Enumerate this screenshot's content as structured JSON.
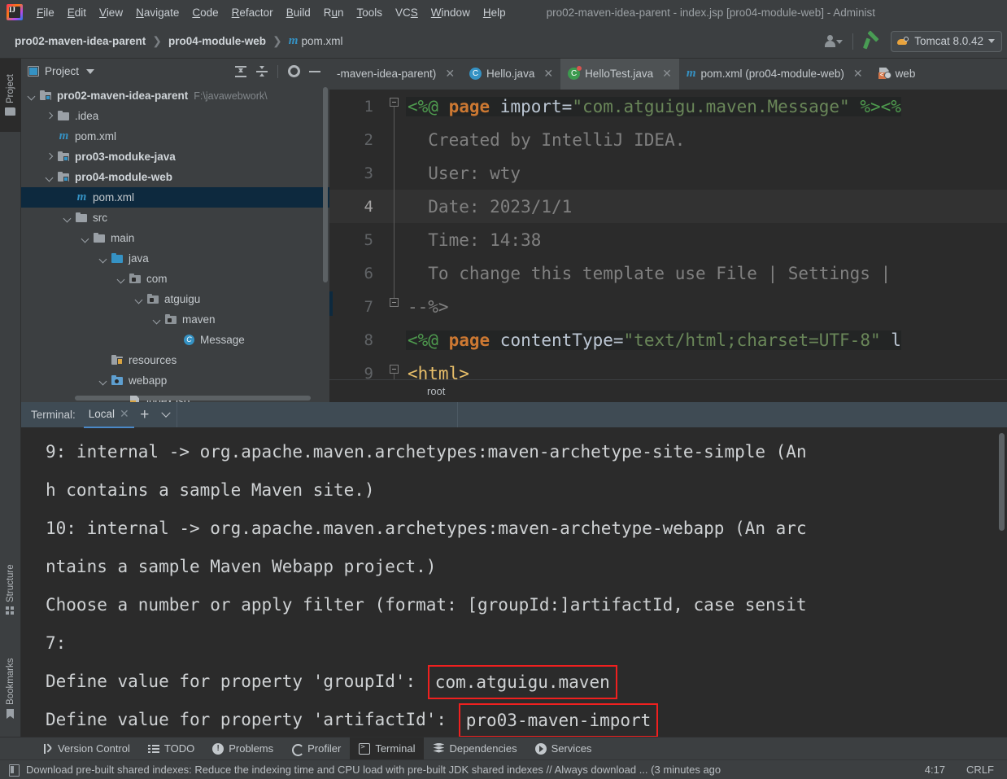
{
  "menubar": {
    "logo_icon": "intellij-idea-logo",
    "items": [
      "File",
      "Edit",
      "View",
      "Navigate",
      "Code",
      "Refactor",
      "Build",
      "Run",
      "Tools",
      "VCS",
      "Window",
      "Help"
    ],
    "window_title": "pro02-maven-idea-parent - index.jsp [pro04-module-web] - Administ"
  },
  "navbar": {
    "breadcrumbs": [
      {
        "label": "pro02-maven-idea-parent",
        "bold": true,
        "icon": null
      },
      {
        "label": "pro04-module-web",
        "bold": true,
        "icon": null
      },
      {
        "label": "pom.xml",
        "bold": false,
        "icon": "maven-m-icon"
      }
    ],
    "account_icon": "user-account-icon",
    "build_icon": "hammer-build-icon",
    "run_config": {
      "label": "Tomcat 8.0.42",
      "icon": "tomcat-icon",
      "caret": "chevron-down-icon"
    }
  },
  "left_strip": {
    "tabs": [
      {
        "label": "Project",
        "icon": "folder-icon",
        "selected": true
      },
      {
        "label": "Structure",
        "icon": "structure-squares-icon",
        "selected": false
      },
      {
        "label": "Bookmarks",
        "icon": "bookmark-icon",
        "selected": false
      }
    ]
  },
  "project_panel": {
    "title": "Project",
    "title_icon": "project-view-icon",
    "dropdown_icon": "chevron-down-icon",
    "tools": [
      {
        "name": "expand-all-icon"
      },
      {
        "name": "collapse-all-icon"
      },
      {
        "name": "gear-settings-icon"
      },
      {
        "name": "hide-panel-icon"
      }
    ],
    "tree": [
      {
        "indent": 0,
        "arrow": "down",
        "icon": "module-folder-icon",
        "label": "pro02-maven-idea-parent",
        "bold": true,
        "path": "F:\\javawebwork\\",
        "selected": false
      },
      {
        "indent": 1,
        "arrow": "right",
        "icon": "folder-icon",
        "label": ".idea",
        "bold": false,
        "path": "",
        "selected": false
      },
      {
        "indent": 1,
        "arrow": "none",
        "icon": "maven-m-icon",
        "label": "pom.xml",
        "bold": false,
        "path": "",
        "selected": false
      },
      {
        "indent": 1,
        "arrow": "right",
        "icon": "module-folder-icon",
        "label": "pro03-moduke-java",
        "bold": true,
        "path": "",
        "selected": false
      },
      {
        "indent": 1,
        "arrow": "down",
        "icon": "module-folder-icon",
        "label": "pro04-module-web",
        "bold": true,
        "path": "",
        "selected": false
      },
      {
        "indent": 2,
        "arrow": "none",
        "icon": "maven-m-icon",
        "label": "pom.xml",
        "bold": false,
        "path": "",
        "selected": true
      },
      {
        "indent": 2,
        "arrow": "down",
        "icon": "folder-icon",
        "label": "src",
        "bold": false,
        "path": "",
        "selected": false
      },
      {
        "indent": 3,
        "arrow": "down",
        "icon": "folder-icon",
        "label": "main",
        "bold": false,
        "path": "",
        "selected": false
      },
      {
        "indent": 4,
        "arrow": "down",
        "icon": "source-folder-icon",
        "label": "java",
        "bold": false,
        "path": "",
        "selected": false
      },
      {
        "indent": 5,
        "arrow": "down",
        "icon": "package-icon",
        "label": "com",
        "bold": false,
        "path": "",
        "selected": false
      },
      {
        "indent": 6,
        "arrow": "down",
        "icon": "package-icon",
        "label": "atguigu",
        "bold": false,
        "path": "",
        "selected": false
      },
      {
        "indent": 7,
        "arrow": "down",
        "icon": "package-icon",
        "label": "maven",
        "bold": false,
        "path": "",
        "selected": false
      },
      {
        "indent": 8,
        "arrow": "none",
        "icon": "java-class-icon",
        "label": "Message",
        "bold": false,
        "path": "",
        "selected": false
      },
      {
        "indent": 4,
        "arrow": "none",
        "icon": "resources-folder-icon",
        "label": "resources",
        "bold": false,
        "path": "",
        "selected": false
      },
      {
        "indent": 4,
        "arrow": "down",
        "icon": "webapp-folder-icon",
        "label": "webapp",
        "bold": false,
        "path": "",
        "selected": false
      },
      {
        "indent": 5,
        "arrow": "none",
        "icon": "jsp-file-icon",
        "label": "index.jsp",
        "bold": false,
        "path": "",
        "selected": false
      }
    ]
  },
  "editor": {
    "tabs": [
      {
        "label": "-maven-idea-parent)",
        "icon": null,
        "active": false,
        "closable": true
      },
      {
        "label": "Hello.java",
        "icon": "java-class-icon",
        "active": false,
        "closable": true
      },
      {
        "label": "HelloTest.java",
        "icon": "java-test-icon",
        "active": true,
        "closable": true
      },
      {
        "label": "pom.xml (pro04-module-web)",
        "icon": "maven-m-icon",
        "active": false,
        "closable": true
      },
      {
        "label": "web",
        "icon": "jsp-file-icon",
        "active": false,
        "closable": false
      }
    ],
    "lines": [
      {
        "num": "1",
        "fold": "start",
        "current": false,
        "highlight": true,
        "segments": [
          {
            "text": "<%@ ",
            "cls": "c-tag"
          },
          {
            "text": "page",
            "cls": "c-kw"
          },
          {
            "text": " import=",
            "cls": "c-attr"
          },
          {
            "text": "\"com.atguigu.maven.Message\"",
            "cls": "c-str"
          },
          {
            "text": " %>",
            "cls": "c-tag"
          },
          {
            "text": "<%",
            "cls": "c-tag"
          }
        ]
      },
      {
        "num": "2",
        "fold": "bar",
        "current": false,
        "highlight": false,
        "segments": [
          {
            "text": "  Created by IntelliJ IDEA.",
            "cls": "c-cmt"
          }
        ]
      },
      {
        "num": "3",
        "fold": "bar",
        "current": false,
        "highlight": false,
        "segments": [
          {
            "text": "  User: wty",
            "cls": "c-cmt"
          }
        ]
      },
      {
        "num": "4",
        "fold": "bar",
        "current": true,
        "highlight": false,
        "segments": [
          {
            "text": "  Date: 2023/1/1",
            "cls": "c-cmt"
          }
        ]
      },
      {
        "num": "5",
        "fold": "bar",
        "current": false,
        "highlight": false,
        "segments": [
          {
            "text": "  Time: 14:38",
            "cls": "c-cmt"
          }
        ]
      },
      {
        "num": "6",
        "fold": "bar",
        "current": false,
        "highlight": false,
        "segments": [
          {
            "text": "  To change this template use File | Settings |",
            "cls": "c-cmt"
          }
        ]
      },
      {
        "num": "7",
        "fold": "end",
        "current": false,
        "highlight": false,
        "segments": [
          {
            "text": "--%>",
            "cls": "c-cmt"
          }
        ]
      },
      {
        "num": "8",
        "fold": "none",
        "current": false,
        "highlight": true,
        "segments": [
          {
            "text": "<%@ ",
            "cls": "c-tag"
          },
          {
            "text": "page",
            "cls": "c-kw"
          },
          {
            "text": " contentType=",
            "cls": "c-attr"
          },
          {
            "text": "\"text/html;charset=UTF-8\"",
            "cls": "c-str"
          },
          {
            "text": " l",
            "cls": "c-attr"
          }
        ]
      },
      {
        "num": "9",
        "fold": "start",
        "current": false,
        "highlight": false,
        "segments": [
          {
            "text": "<html>",
            "cls": "c-html"
          }
        ]
      }
    ],
    "breadcrumb": "root"
  },
  "terminal": {
    "label": "Terminal:",
    "tab": {
      "label": "Local",
      "close_icon": "close-icon"
    },
    "add_icon": "plus-icon",
    "dropdown_icon": "chevron-down-icon",
    "lines": [
      {
        "text": "9: internal -> org.apache.maven.archetypes:maven-archetype-site-simple (An",
        "box": null,
        "box_text": null
      },
      {
        "text": "h contains a sample Maven site.)",
        "box": null,
        "box_text": null
      },
      {
        "text": "10: internal -> org.apache.maven.archetypes:maven-archetype-webapp (An arc",
        "box": null,
        "box_text": null
      },
      {
        "text": "ntains a sample Maven Webapp project.)",
        "box": null,
        "box_text": null
      },
      {
        "text": "Choose a number or apply filter (format: [groupId:]artifactId, case sensit",
        "box": null,
        "box_text": null
      },
      {
        "text": "7:",
        "box": null,
        "box_text": null
      },
      {
        "text": "Define value for property 'groupId': ",
        "box": "red",
        "box_text": "com.atguigu.maven"
      },
      {
        "text": "Define value for property 'artifactId': ",
        "box": "red",
        "box_text": "pro03-maven-import"
      }
    ],
    "highlight_color": "#f0201f"
  },
  "bottom_bar": {
    "items": [
      {
        "label": "Version Control",
        "icon": "version-control-icon",
        "active": false
      },
      {
        "label": "TODO",
        "icon": "todo-list-icon",
        "active": false
      },
      {
        "label": "Problems",
        "icon": "problems-icon",
        "active": false
      },
      {
        "label": "Profiler",
        "icon": "profiler-icon",
        "active": false
      },
      {
        "label": "Terminal",
        "icon": "terminal-icon",
        "active": true
      },
      {
        "label": "Dependencies",
        "icon": "dependencies-icon",
        "active": false
      },
      {
        "label": "Services",
        "icon": "services-icon",
        "active": false
      }
    ]
  },
  "status_bar": {
    "icon": "notification-icon",
    "message": "Download pre-built shared indexes: Reduce the indexing time and CPU load with pre-built JDK shared indexes // Always download ... (3 minutes ago",
    "caret_position": "4:17",
    "line_separator": "CRLF"
  }
}
